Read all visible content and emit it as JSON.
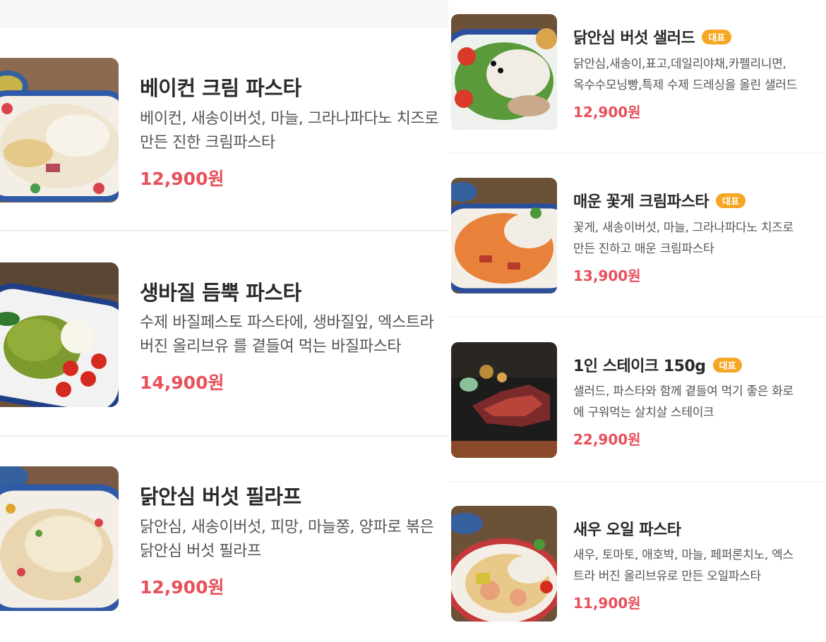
{
  "left_items": [
    {
      "title": "베이컨 크림 파스타",
      "desc": "베이컨, 새송이버섯, 마늘, 그라나파다노 치즈로 만든 진한 크림파스타",
      "price": "12,900원",
      "image": "bacon-cream-pasta-image"
    },
    {
      "title": "생바질 듬뿍 파스타",
      "desc": "수제 바질페스토 파스타에, 생바질잎, 엑스트라 버진 올리브유 를 곁들여 먹는 바질파스타",
      "price": "14,900원",
      "image": "basil-pasta-image"
    },
    {
      "title": "닭안심 버섯 필라프",
      "desc": "닭안심, 새송이버섯, 피망, 마늘쫑, 양파로 볶은 닭안심 버섯 필라프",
      "price": "12,900원",
      "image": "chicken-pilaf-image"
    }
  ],
  "right_items": [
    {
      "title": "닭안심 버섯 샐러드",
      "badge": "대표",
      "desc_line1": "닭안심,새송이,표고,데일리야채,카펠리니면,",
      "desc_line2": "옥수수모닝빵,특제 수제 드레싱을 올린 샐러드",
      "price": "12,900원",
      "image": "chicken-salad-image"
    },
    {
      "title": "매운 꽃게 크림파스타",
      "badge": "대표",
      "desc_line1": "꽃게, 새송이버섯, 마늘, 그라나파다노 치즈로",
      "desc_line2": "만든 진하고 매운 크림파스타",
      "price": "13,900원",
      "image": "crab-pasta-image"
    },
    {
      "title": "1인 스테이크 150g",
      "badge": "대표",
      "desc_line1": "샐러드, 파스타와 함께 곁들여 먹기 좋은 화로",
      "desc_line2": "에 구워먹는 살치살 스테이크",
      "price": "22,900원",
      "image": "steak-image"
    },
    {
      "title": "새우 오일 파스타",
      "badge": "",
      "desc_line1": "새우, 토마토, 애호박, 마늘, 페퍼론치노, 엑스",
      "desc_line2": "트라 버진 올리브유로 만든 오일파스타",
      "price": "11,900원",
      "image": "shrimp-pasta-image"
    }
  ],
  "colors": {
    "price": "#e8505b",
    "badge": "#f5a623",
    "divider": "#ececee"
  }
}
